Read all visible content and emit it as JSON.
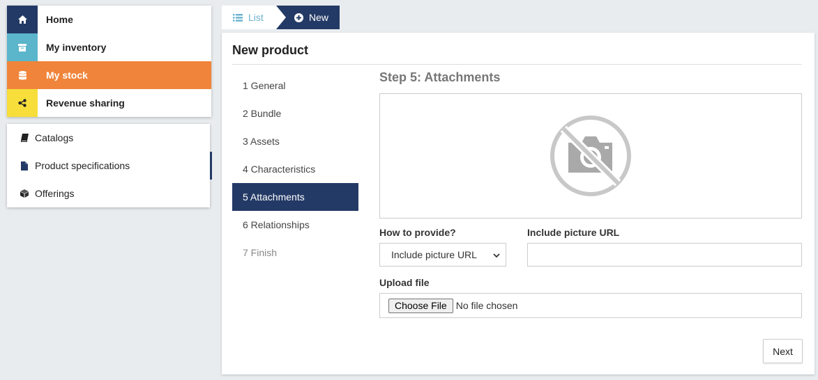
{
  "main_nav": {
    "items": [
      {
        "label": "Home",
        "icon": "home-icon",
        "color": "#243a66"
      },
      {
        "label": "My inventory",
        "icon": "archive-icon",
        "color": "#5bb5cb"
      },
      {
        "label": "My stock",
        "icon": "database-icon",
        "color": "#f0843a"
      },
      {
        "label": "Revenue sharing",
        "icon": "share-icon",
        "color": "#f7de3a"
      }
    ],
    "active": "My stock"
  },
  "sub_nav": {
    "items": [
      {
        "label": "Catalogs",
        "icon": "book-icon"
      },
      {
        "label": "Product specifications",
        "icon": "file-icon"
      },
      {
        "label": "Offerings",
        "icon": "cube-icon"
      }
    ],
    "selected": "Product specifications"
  },
  "tabs": {
    "list_label": "List",
    "new_label": "New"
  },
  "panel": {
    "title": "New product",
    "steps": [
      "1 General",
      "2 Bundle",
      "3 Assets",
      "4 Characteristics",
      "5 Attachments",
      "6 Relationships",
      "7 Finish"
    ],
    "active_step": "5 Attachments",
    "step_title": "Step 5: Attachments",
    "how_label": "How to provide?",
    "how_value": "Include picture URL",
    "url_label": "Include picture URL",
    "url_value": "",
    "upload_label": "Upload file",
    "choose_label": "Choose File",
    "no_file_text": "No file chosen",
    "next_label": "Next"
  },
  "colors": {
    "primary": "#243a66",
    "active_orange": "#f0843a",
    "list_tab": "#6db3d0",
    "background": "#e9ecef"
  }
}
